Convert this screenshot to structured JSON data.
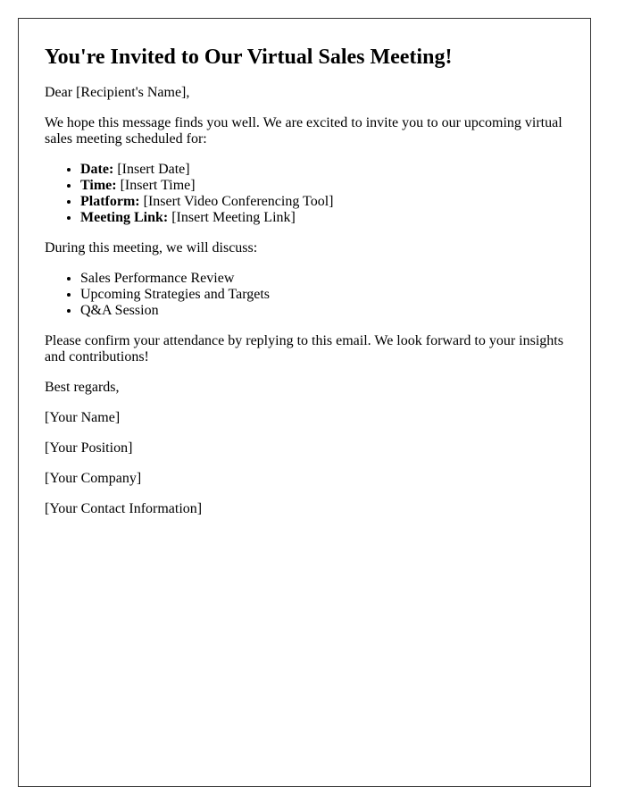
{
  "title": "You're Invited to Our Virtual Sales Meeting!",
  "greeting": "Dear [Recipient's Name],",
  "intro": "We hope this message finds you well. We are excited to invite you to our upcoming virtual sales meeting scheduled for:",
  "details": [
    {
      "label": "Date:",
      "value": " [Insert Date]"
    },
    {
      "label": "Time:",
      "value": " [Insert Time]"
    },
    {
      "label": "Platform:",
      "value": " [Insert Video Conferencing Tool]"
    },
    {
      "label": "Meeting Link:",
      "value": " [Insert Meeting Link]"
    }
  ],
  "agenda_intro": "During this meeting, we will discuss:",
  "agenda": [
    "Sales Performance Review",
    "Upcoming Strategies and Targets",
    "Q&A Session"
  ],
  "closing_request": "Please confirm your attendance by replying to this email. We look forward to your insights and contributions!",
  "sign_off": "Best regards,",
  "signature": {
    "name": "[Your Name]",
    "position": "[Your Position]",
    "company": "[Your Company]",
    "contact": "[Your Contact Information]"
  }
}
